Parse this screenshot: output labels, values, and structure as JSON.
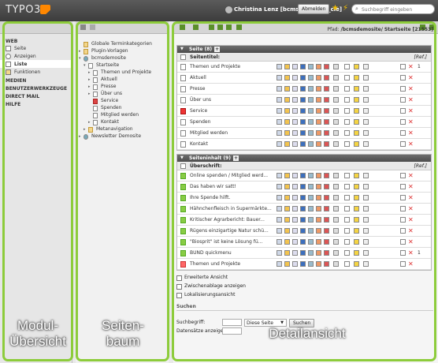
{
  "app": {
    "name": "TYPO3"
  },
  "topbar": {
    "user": "Christina Lenz [bcmsdemosite_cle]",
    "logout_label": "Abmelden",
    "search_placeholder": "Suchbegriff eingeben",
    "accent": "#ff8700"
  },
  "modules": {
    "web": "WEB",
    "seite": "Seite",
    "anzeigen": "Anzeigen",
    "liste": "Liste",
    "funktionen": "Funktionen",
    "medien": "MEDIEN",
    "benutzer": "BENUTZERWERKZEUGE",
    "directmail": "DIRECT MAIL",
    "hilfe": "HILFE"
  },
  "tree": {
    "items": [
      {
        "label": "Globale Terminkategorien"
      },
      {
        "label": "Plugin-Vorlagen"
      },
      {
        "label": "bcmsdemosite"
      },
      {
        "label": "Startseite"
      },
      {
        "label": "Themen und Projekte"
      },
      {
        "label": "Aktuell"
      },
      {
        "label": "Presse"
      },
      {
        "label": "Über uns"
      },
      {
        "label": "Service"
      },
      {
        "label": "Spenden"
      },
      {
        "label": "Mitglied werden"
      },
      {
        "label": "Kontakt"
      },
      {
        "label": "Metanavigation"
      },
      {
        "label": "Newsletter Demosite"
      }
    ]
  },
  "detail": {
    "pfad_label": "Pfad:",
    "pfad_path": "/bcmsdemosite/",
    "pfad_page": "Startseite [21553]",
    "seite_section": {
      "title": "Seite (8)",
      "subheader": "Seitentitel:",
      "ref": "[Ref.]",
      "rows": [
        {
          "label": "Themen und Projekte",
          "count": "1"
        },
        {
          "label": "Aktuell",
          "count": ""
        },
        {
          "label": "Presse",
          "count": ""
        },
        {
          "label": "Über uns",
          "count": ""
        },
        {
          "label": "Service",
          "count": ""
        },
        {
          "label": "Spenden",
          "count": ""
        },
        {
          "label": "Mitglied werden",
          "count": ""
        },
        {
          "label": "Kontakt",
          "count": ""
        }
      ]
    },
    "inhalt_section": {
      "title": "Seiteninhalt (9)",
      "subheader": "Überschrift:",
      "ref": "[Ref.]",
      "rows": [
        {
          "label": "Online spenden / Mitglied werd...",
          "count": ""
        },
        {
          "label": "Das haben wir satt!",
          "count": ""
        },
        {
          "label": "Ihre Spende hilft.",
          "count": ""
        },
        {
          "label": "Hähnchenfleisch in Supermärkte...",
          "count": ""
        },
        {
          "label": "Kritischer Agrarbericht: Bauer...",
          "count": ""
        },
        {
          "label": "Rügens einzigartige Natur schü...",
          "count": ""
        },
        {
          "label": "\"Biosprit\" ist keine Lösung fü...",
          "count": ""
        },
        {
          "label": "BUND quickmenu",
          "count": "1"
        },
        {
          "label": "Themen und Projekte",
          "count": ""
        }
      ]
    },
    "checkboxes": [
      {
        "label": "Erweiterte Ansicht"
      },
      {
        "label": "Zwischenablage anzeigen"
      },
      {
        "label": "Lokalisierungsansicht"
      }
    ],
    "search": {
      "title": "Suchen",
      "label": "Suchbegriff:",
      "select_value": "Diese Seite",
      "button": "Suchen",
      "ds_label": "Datensätze anzeigen:"
    }
  },
  "overlay": {
    "modul_line1": "Modul-",
    "modul_line2": "Übersicht",
    "seiten_line1": "Seiten-",
    "seiten_line2": "baum",
    "detail": "Detailansicht",
    "frame_color": "#8dcc3b"
  }
}
